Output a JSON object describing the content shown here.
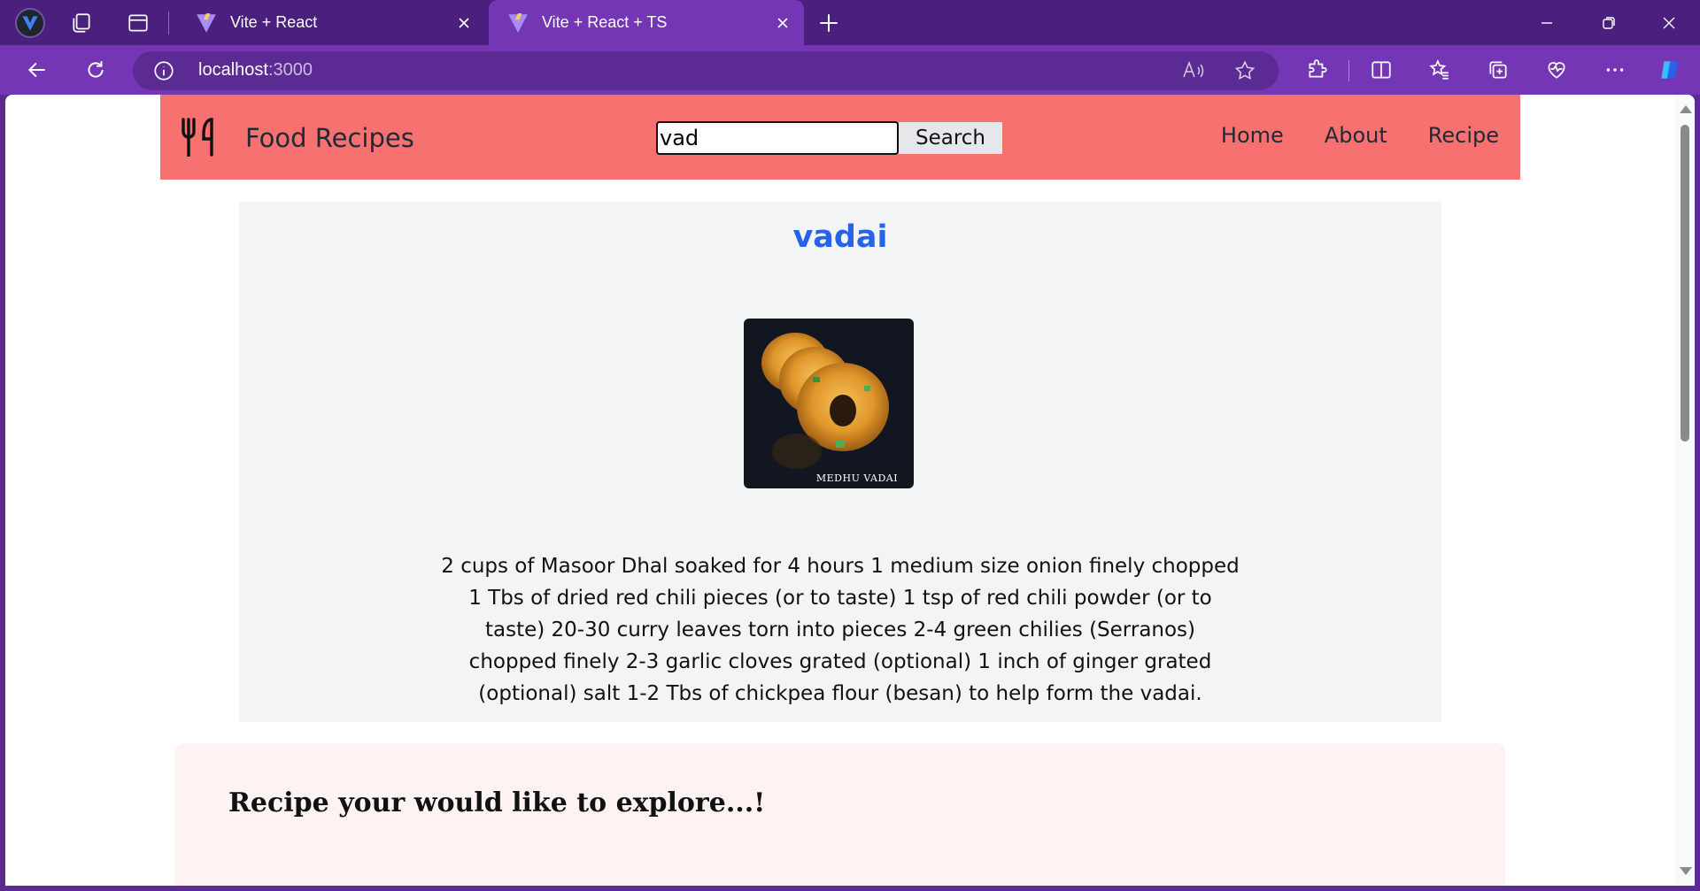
{
  "browser": {
    "tabs": [
      {
        "title": "Vite + React",
        "active": false
      },
      {
        "title": "Vite + React + TS",
        "active": true
      }
    ],
    "address": {
      "host": "localhost",
      "port": ":3000"
    }
  },
  "colors": {
    "browser_frame": "#4a1f7e",
    "toolbar": "#7436b4",
    "navbar": "#f87171",
    "recipe_title": "#2563eb",
    "card_bg": "#f3f4f6",
    "explore_bg": "#fef2f2"
  },
  "navbar": {
    "logo_icon": "utensils-icon",
    "title": "Food Recipes",
    "search": {
      "value": "vad",
      "button_label": "Search"
    },
    "links": [
      {
        "label": "Home"
      },
      {
        "label": "About"
      },
      {
        "label": "Recipe"
      }
    ]
  },
  "recipe": {
    "name": "vadai",
    "image_caption": "MEDHU VADAI",
    "description": "2 cups of Masoor Dhal soaked for 4 hours 1 medium size onion finely chopped 1 Tbs of dried red chili pieces (or to taste) 1 tsp of red chili powder (or to taste) 20-30 curry leaves torn into pieces 2-4 green chilies (Serranos) chopped finely 2-3 garlic cloves grated (optional) 1 inch of ginger grated (optional) salt 1-2 Tbs of chickpea flour (besan) to help form the vadai."
  },
  "explore": {
    "title": "Recipe your would like to explore...!"
  }
}
